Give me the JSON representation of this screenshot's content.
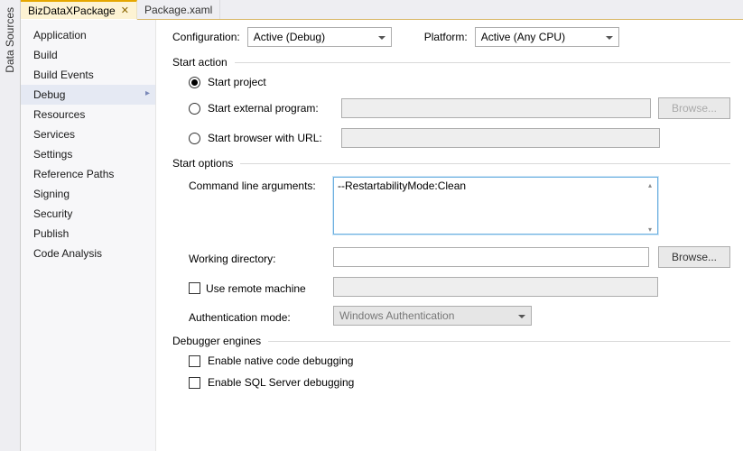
{
  "sidepanel": {
    "title": "Data Sources"
  },
  "tabs": [
    {
      "label": "BizDataXPackage",
      "active": true,
      "closable": true
    },
    {
      "label": "Package.xaml",
      "active": false,
      "closable": false
    }
  ],
  "nav": {
    "items": [
      "Application",
      "Build",
      "Build Events",
      "Debug",
      "Resources",
      "Services",
      "Settings",
      "Reference Paths",
      "Signing",
      "Security",
      "Publish",
      "Code Analysis"
    ],
    "selected": 3
  },
  "topbar": {
    "configLabel": "Configuration:",
    "configValue": "Active (Debug)",
    "platformLabel": "Platform:",
    "platformValue": "Active (Any CPU)"
  },
  "startAction": {
    "legend": "Start action",
    "opts": {
      "project": "Start project",
      "external": "Start external program:",
      "browser": "Start browser with URL:"
    },
    "selected": "project",
    "browseLabel": "Browse..."
  },
  "startOptions": {
    "legend": "Start options",
    "cmdArgsLabel": "Command line arguments:",
    "cmdArgsValue": "--RestartabilityMode:Clean",
    "workDirLabel": "Working directory:",
    "workDirValue": "",
    "browseLabel": "Browse...",
    "remoteLabel": "Use remote machine",
    "remoteChecked": false,
    "authLabel": "Authentication mode:",
    "authValue": "Windows Authentication"
  },
  "debugEngines": {
    "legend": "Debugger engines",
    "native": {
      "label": "Enable native code debugging",
      "checked": false
    },
    "sql": {
      "label": "Enable SQL Server debugging",
      "checked": false
    }
  }
}
